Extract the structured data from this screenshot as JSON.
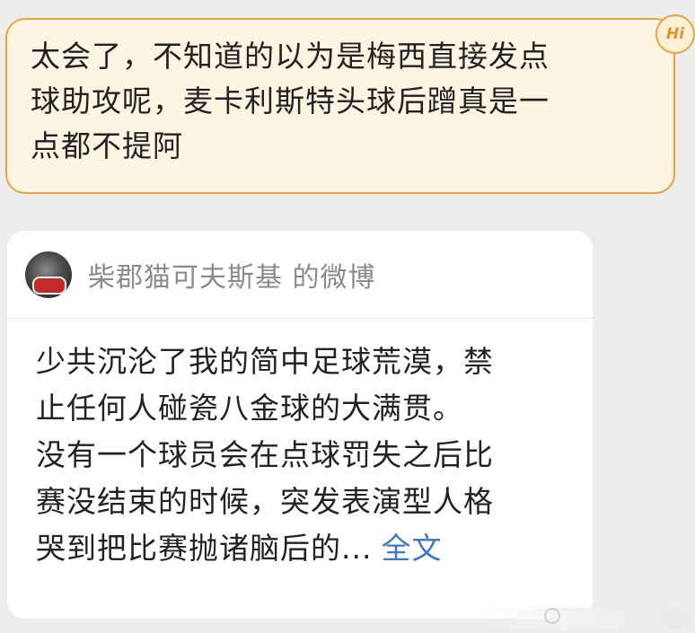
{
  "comment": {
    "lines": [
      "太会了，不知道的以为是梅西直接发点",
      "球助攻呢，麦卡利斯特头球后蹭真是一",
      "点都不提阿"
    ],
    "badge": "Hi"
  },
  "card": {
    "author": "柴郡猫可夫斯基 的微博",
    "lines": [
      "少共沉沦了我的简中足球荒漠，禁",
      "止任何人碰瓷八金球的大满贯。",
      "没有一个球员会在点球罚失之后比",
      "赛没结束的时候，突发表演型人格",
      "哭到把比赛抛诸脑后的..."
    ],
    "more_link": "全文"
  },
  "colors": {
    "bubble_bg": "#fdf4e1",
    "bubble_border": "#e8a53f",
    "link": "#3f78c2",
    "page_bg": "#ededed"
  }
}
